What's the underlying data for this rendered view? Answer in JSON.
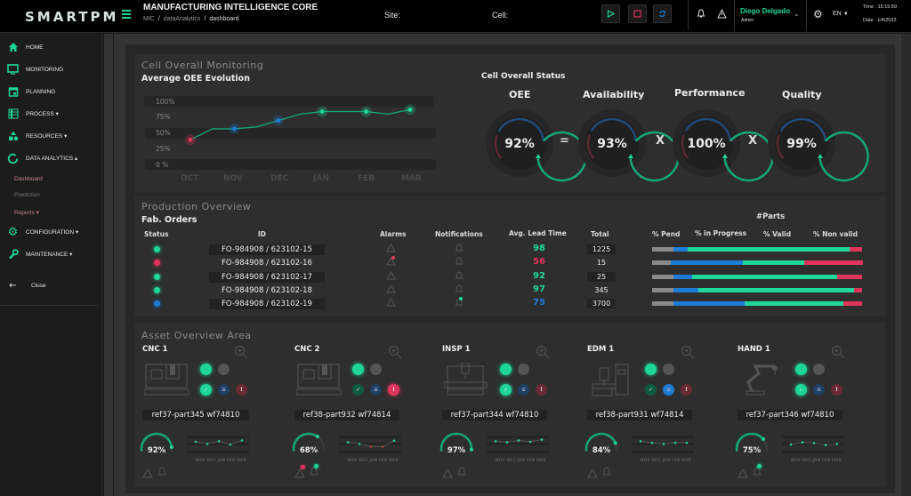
{
  "topbar": {
    "logo": "SMARTPM",
    "title": "MANUFACTURING INTELLIGENCE CORE",
    "breadcrumb": [
      "MIC",
      "dataAnalytics",
      "dashboard"
    ],
    "site_label": "Site:",
    "cell_label": "Cell:",
    "controls": [
      {
        "name": "play",
        "icon": "play-icon",
        "color": "#1ed69a"
      },
      {
        "name": "stop",
        "icon": "stop-icon",
        "color": "#e0345f"
      },
      {
        "name": "refresh",
        "icon": "refresh-icon",
        "color": "#1c7cd6"
      }
    ],
    "user_name": "Diego Delgado",
    "user_role": "Admin",
    "language": "EN",
    "time": "Time : 15:15:59",
    "date": "Date : 1/4/2022"
  },
  "sidebar": {
    "items": [
      {
        "label": "HOME",
        "icon": "home-icon",
        "caret": ""
      },
      {
        "label": "MONITORING",
        "icon": "monitor-icon",
        "caret": ""
      },
      {
        "label": "PLANNING",
        "icon": "calendar-icon",
        "caret": ""
      },
      {
        "label": "PROCESS",
        "icon": "process-icon",
        "caret": "▾"
      },
      {
        "label": "RESOURCES",
        "icon": "resources-icon",
        "caret": "▾"
      },
      {
        "label": "DATA ANALYTICS",
        "icon": "analytics-icon",
        "caret": "▴"
      },
      {
        "label": "CONFIGURATION",
        "icon": "gear-icon",
        "caret": "▾"
      },
      {
        "label": "MAINTENANCE",
        "icon": "wrench-icon",
        "caret": "▾"
      }
    ],
    "sub_items": [
      {
        "label": "Dashboard",
        "color": "#c9848c"
      },
      {
        "label": "Prediction",
        "color": "#777777"
      },
      {
        "label": "Reports ▾",
        "color": "#c9848c"
      }
    ],
    "close_label": "Close"
  },
  "monitoring": {
    "title": "Cell Overall Monitoring",
    "subtitle": "Average OEE Evolution"
  },
  "chart_data": {
    "type": "line",
    "title": "Average OEE Evolution",
    "categories": [
      "OCT",
      "NOV",
      "DEC",
      "JAN",
      "FEB",
      "MAR"
    ],
    "x": [
      "OCT",
      "mid-OCT/NOV",
      "NOV",
      "mid-NOV/DEC",
      "DEC",
      "mid-DEC/JAN",
      "JAN",
      "mid-JAN/FEB",
      "FEB",
      "mid-FEB/MAR",
      "MAR"
    ],
    "values": [
      40,
      57,
      57,
      60,
      70,
      80,
      84,
      84,
      84,
      80,
      87
    ],
    "markers": [
      {
        "month": "OCT",
        "value": 40,
        "color": "#e0345f"
      },
      {
        "month": "NOV",
        "value": 57,
        "color": "#1c7cd6"
      },
      {
        "month": "DEC",
        "value": 70,
        "color": "#1c7cd6"
      },
      {
        "month": "JAN",
        "value": 84,
        "color": "#1ed69a"
      },
      {
        "month": "FEB",
        "value": 84,
        "color": "#1ed69a"
      },
      {
        "month": "MAR",
        "value": 87,
        "color": "#1ed69a"
      }
    ],
    "yticks": [
      "100%",
      "75%",
      "50%",
      "25%",
      "0 %"
    ],
    "ylim": [
      0,
      100
    ],
    "xlabel": "",
    "ylabel": "",
    "grid": true,
    "line_color": "#13a77a"
  },
  "status": {
    "title": "Cell Overall Status",
    "gauges": [
      {
        "label": "OEE",
        "value": "92%",
        "pct": 92
      },
      {
        "label": "Availability",
        "value": "93%",
        "pct": 93
      },
      {
        "label": "Performance",
        "value": "100%",
        "pct": 100
      },
      {
        "label": "Quality",
        "value": "99%",
        "pct": 99
      }
    ],
    "operators": [
      "=",
      "X",
      "X"
    ]
  },
  "production": {
    "title": "Production Overview",
    "subtitle": "Fab. Orders",
    "headers": {
      "status": "Status",
      "id": "ID",
      "alarms": "Alarms",
      "notifications": "Notifications",
      "lead": "Avg. Lead Time",
      "total": "Total",
      "parts": "#Parts",
      "pend": "% Pend",
      "progress": "% in Progress",
      "valid": "% Valid",
      "nonvalid": "% Non valid"
    },
    "rows": [
      {
        "status": "#1ed69a",
        "id": "FO-984908 / 623102-15",
        "alarm": false,
        "notification": false,
        "lead": "98",
        "lead_color": "#1ed69a",
        "total": "1225",
        "parts": [
          10,
          7,
          77,
          6
        ]
      },
      {
        "status": "#e0345f",
        "id": "FO-984908 / 623102-16",
        "alarm": true,
        "notification": false,
        "lead": "56",
        "lead_color": "#e0345f",
        "total": "15",
        "parts": [
          9,
          34,
          29,
          28
        ]
      },
      {
        "status": "#1ed69a",
        "id": "FO-984908 / 623102-17",
        "alarm": false,
        "notification": false,
        "lead": "92",
        "lead_color": "#1ed69a",
        "total": "25",
        "parts": [
          10,
          9,
          69,
          12
        ]
      },
      {
        "status": "#1ed69a",
        "id": "FO-984908 / 623102-18",
        "alarm": false,
        "notification": false,
        "lead": "97",
        "lead_color": "#1ed69a",
        "total": "345",
        "parts": [
          10,
          12,
          74,
          4
        ]
      },
      {
        "status": "#1c7cd6",
        "id": "FO-984908 / 623102-19",
        "alarm": false,
        "notification": true,
        "lead": "75",
        "lead_color": "#1c7cd6",
        "total": "3700",
        "parts": [
          10,
          34,
          47,
          9
        ]
      }
    ],
    "part_colors": [
      "#8a8a8a",
      "#1c7cd6",
      "#1ed69a",
      "#e0345f"
    ]
  },
  "assets": {
    "title": "Asset Overview Area",
    "months": "NOV DEC JAN FEB MAR",
    "items": [
      {
        "name": "CNC 1",
        "ref": "ref37-part345 wf74810",
        "oee": "92%",
        "pct": 92,
        "alarm": false,
        "notification": false,
        "trend": [
          80,
          72,
          82,
          70,
          85
        ],
        "error_active": false,
        "info_active": false,
        "check_active": true
      },
      {
        "name": "CNC 2",
        "ref": "ref38-part932 wf74814",
        "oee": "68%",
        "pct": 68,
        "alarm": true,
        "notification": true,
        "trend": [
          78,
          72,
          62,
          62,
          84
        ],
        "error_active": true,
        "info_active": false,
        "check_active": false
      },
      {
        "name": "INSP 1",
        "ref": "ref37-part344 wf74810",
        "oee": "97%",
        "pct": 97,
        "alarm": false,
        "notification": false,
        "trend": [
          82,
          78,
          85,
          80,
          88
        ],
        "error_active": false,
        "info_active": false,
        "check_active": true
      },
      {
        "name": "EDM 1",
        "ref": "ref38-part931 wf74814",
        "oee": "84%",
        "pct": 84,
        "alarm": false,
        "notification": false,
        "trend": [
          82,
          76,
          72,
          76,
          76
        ],
        "error_active": false,
        "info_active": true,
        "check_active": false
      },
      {
        "name": "HAND 1",
        "ref": "ref37-part346 wf74810",
        "oee": "75%",
        "pct": 75,
        "alarm": false,
        "notification": true,
        "trend": [
          70,
          78,
          75,
          68,
          72
        ],
        "error_active": false,
        "info_active": false,
        "check_active": true
      }
    ]
  }
}
